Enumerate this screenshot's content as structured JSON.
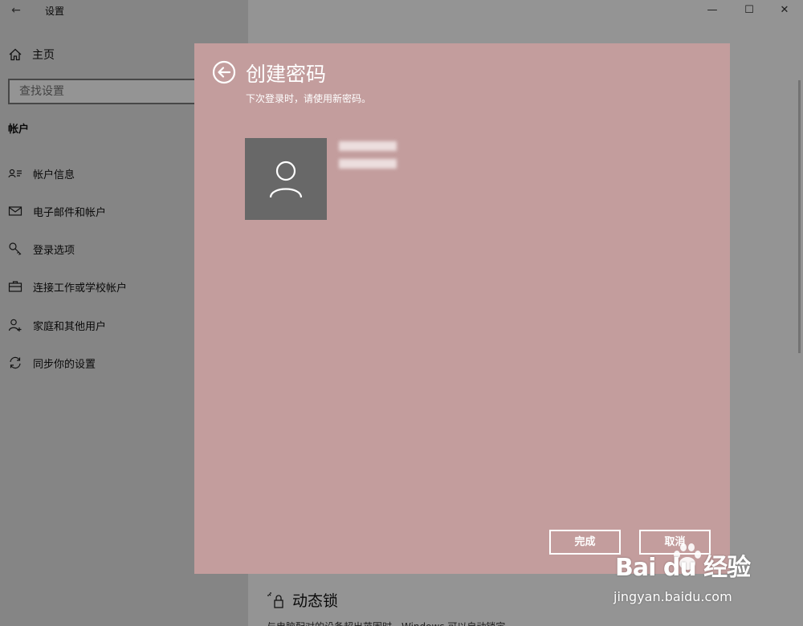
{
  "window": {
    "title": "设置",
    "back_glyph": "←",
    "minimize_glyph": "—",
    "maximize_glyph": "☐",
    "close_glyph": "✕"
  },
  "sidebar": {
    "home_label": "主页",
    "search_placeholder": "查找设置",
    "section_title": "帐户",
    "items": [
      {
        "label": "帐户信息",
        "icon": "account-info-icon"
      },
      {
        "label": "电子邮件和帐户",
        "icon": "mail-icon"
      },
      {
        "label": "登录选项",
        "icon": "key-icon"
      },
      {
        "label": "连接工作或学校帐户",
        "icon": "briefcase-icon"
      },
      {
        "label": "家庭和其他用户",
        "icon": "person-add-icon"
      },
      {
        "label": "同步你的设置",
        "icon": "sync-icon"
      }
    ]
  },
  "main": {
    "dynamic_lock_heading": "动态锁",
    "dynamic_lock_text": "与电脑配对的设备超出范围时，Windows 可以自动锁定"
  },
  "dialog": {
    "title": "创建密码",
    "subtitle": "下次登录时，请使用新密码。",
    "done_label": "完成",
    "cancel_label": "取消",
    "background_color": "#c39d9d"
  },
  "watermark": {
    "logo_text": "Bai du 经验",
    "url_text": "jingyan.baidu.com"
  }
}
